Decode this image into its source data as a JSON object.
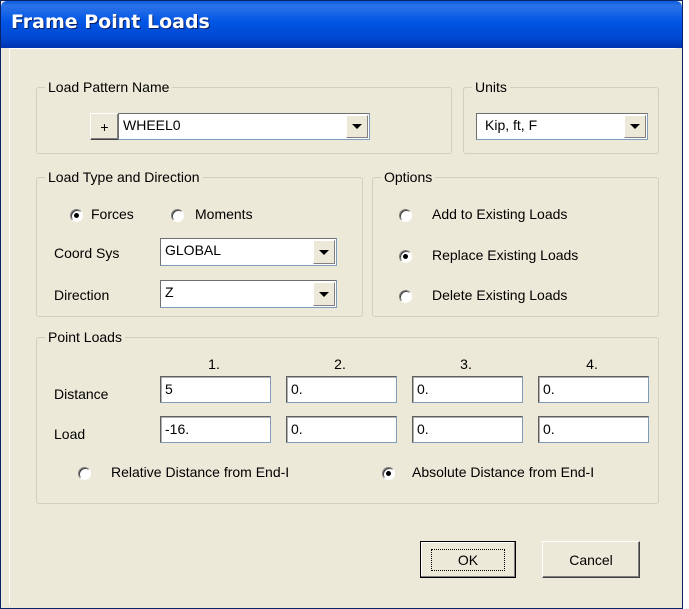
{
  "window": {
    "title": "Frame Point Loads"
  },
  "load_pattern": {
    "legend": "Load Pattern Name",
    "add_button": "+",
    "value": "WHEEL0"
  },
  "units": {
    "legend": "Units",
    "value": "Kip, ft, F"
  },
  "load_type": {
    "legend": "Load Type and Direction",
    "forces_label": "Forces",
    "moments_label": "Moments",
    "selected": "Forces",
    "coord_sys_label": "Coord Sys",
    "coord_sys_value": "GLOBAL",
    "direction_label": "Direction",
    "direction_value": "Z"
  },
  "options": {
    "legend": "Options",
    "add_label": "Add to Existing Loads",
    "replace_label": "Replace Existing Loads",
    "delete_label": "Delete Existing Loads",
    "selected": "Replace Existing Loads"
  },
  "point_loads": {
    "legend": "Point Loads",
    "columns": [
      "1.",
      "2.",
      "3.",
      "4."
    ],
    "distance_label": "Distance",
    "load_label": "Load",
    "distances": [
      "5",
      "0.",
      "0.",
      "0."
    ],
    "loads": [
      "-16.",
      "0.",
      "0.",
      "0."
    ],
    "relative_label": "Relative Distance from End-I",
    "absolute_label": "Absolute Distance from End-I",
    "selected": "Absolute Distance from End-I"
  },
  "buttons": {
    "ok": "OK",
    "cancel": "Cancel"
  }
}
